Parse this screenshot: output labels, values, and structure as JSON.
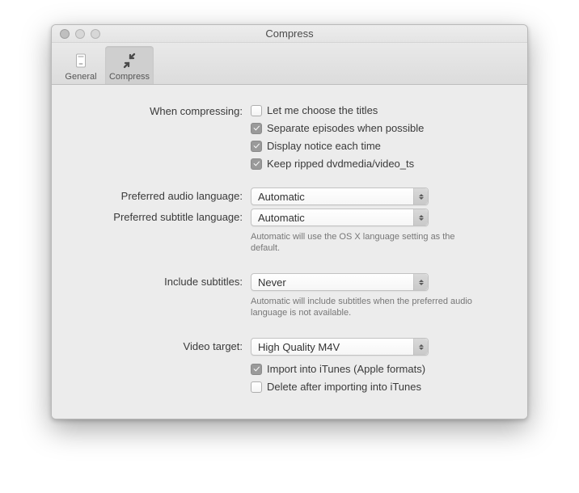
{
  "window": {
    "title": "Compress"
  },
  "toolbar": {
    "items": [
      {
        "label": "General"
      },
      {
        "label": "Compress"
      }
    ]
  },
  "form": {
    "when_compressing": {
      "label": "When compressing:",
      "opts": [
        {
          "label": "Let me choose the titles",
          "checked": false
        },
        {
          "label": "Separate episodes when possible",
          "checked": true
        },
        {
          "label": "Display notice each time",
          "checked": true
        },
        {
          "label": "Keep ripped dvdmedia/video_ts",
          "checked": true
        }
      ]
    },
    "audio_lang": {
      "label": "Preferred audio language:",
      "value": "Automatic"
    },
    "subtitle_lang": {
      "label": "Preferred subtitle language:",
      "value": "Automatic",
      "helper": "Automatic will use the OS X language setting as the default."
    },
    "include_subtitles": {
      "label": "Include subtitles:",
      "value": "Never",
      "helper": "Automatic will include subtitles when the preferred audio language is not available."
    },
    "video_target": {
      "label": "Video target:",
      "value": "High Quality M4V",
      "opts": [
        {
          "label": "Import into iTunes (Apple formats)",
          "checked": true
        },
        {
          "label": "Delete after importing into iTunes",
          "checked": false
        }
      ]
    }
  }
}
